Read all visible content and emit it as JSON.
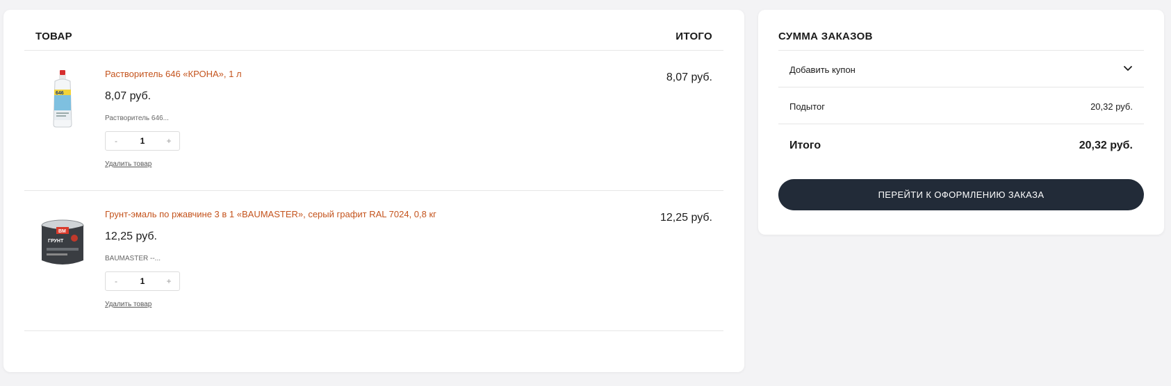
{
  "cart": {
    "header": {
      "product": "ТОВАР",
      "total": "ИТОГО"
    },
    "items": [
      {
        "name": "Растворитель 646 «КРОНА», 1 л",
        "price": "8,07 руб.",
        "meta": "Растворитель 646...",
        "qty": "1",
        "minus": "-",
        "plus": "+",
        "remove": "Удалить товар",
        "total": "8,07 руб.",
        "thumb_icon": "solvent-bottle-image"
      },
      {
        "name": "Грунт-эмаль по ржавчине 3 в 1 «BAUMASTER», серый графит RAL 7024, 0,8 кг",
        "price": "12,25 руб.",
        "meta": "BAUMASTER --...",
        "qty": "1",
        "minus": "-",
        "plus": "+",
        "remove": "Удалить товар",
        "total": "12,25 руб.",
        "thumb_icon": "paint-can-image"
      }
    ]
  },
  "summary": {
    "title": "СУММА ЗАКАЗОВ",
    "coupon_label": "Добавить купон",
    "subtotal_label": "Подытог",
    "subtotal_value": "20,32 руб.",
    "total_label": "Итого",
    "total_value": "20,32 руб.",
    "checkout_label": "ПЕРЕЙТИ К ОФОРМЛЕНИЮ ЗАКАЗА"
  },
  "colors": {
    "accent_link": "#c4531c",
    "button_bg": "#222b38",
    "page_bg": "#f3f3f5"
  }
}
